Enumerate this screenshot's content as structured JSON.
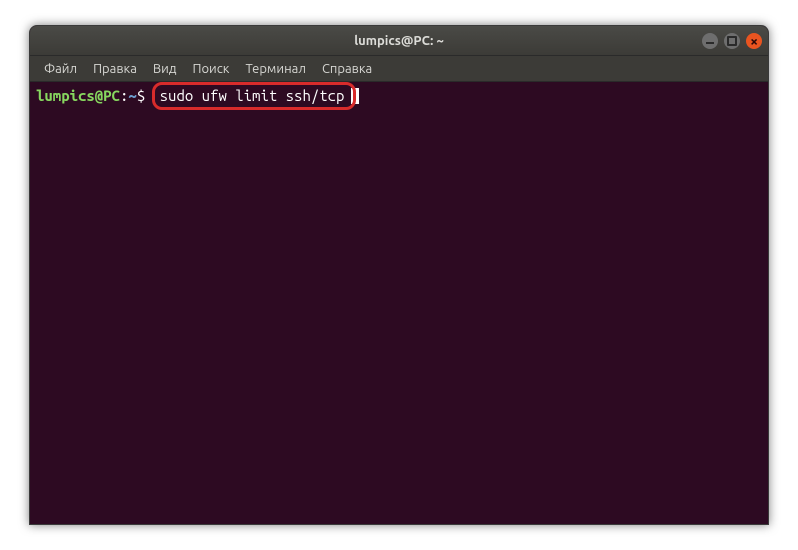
{
  "window": {
    "title": "lumpics@PC: ~"
  },
  "menubar": {
    "items": [
      "Файл",
      "Правка",
      "Вид",
      "Поиск",
      "Терминал",
      "Справка"
    ]
  },
  "terminal": {
    "prompt_user_host": "lumpics@PC",
    "prompt_separator": ":",
    "prompt_path": "~",
    "prompt_symbol": "$",
    "command": "sudo ufw limit ssh/tcp"
  }
}
